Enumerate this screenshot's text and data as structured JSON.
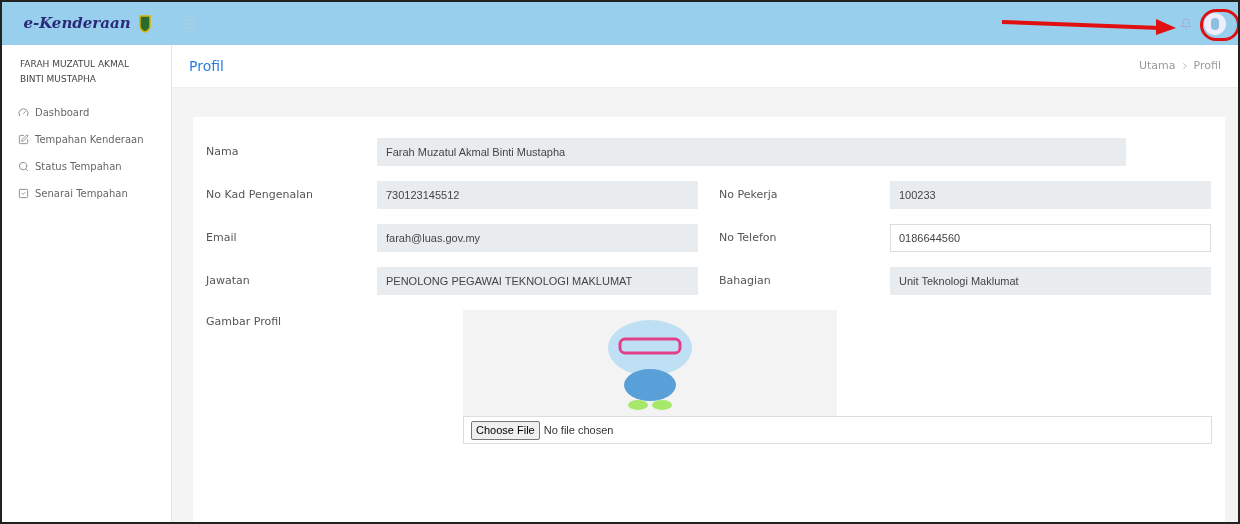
{
  "header": {
    "logo": "e-Kenderaan"
  },
  "sidebar": {
    "user": "FARAH MUZATUL AKMAL BINTI MUSTAPHA",
    "items": [
      {
        "label": "Dashboard",
        "kind": "dashboard"
      },
      {
        "label": "Tempahan Kenderaan",
        "kind": "edit"
      },
      {
        "label": "Status Tempahan",
        "kind": "search"
      },
      {
        "label": "Senarai Tempahan",
        "kind": "check"
      }
    ]
  },
  "page": {
    "title": "Profil",
    "breadcrumb": [
      "Utama",
      "Profil"
    ]
  },
  "form": {
    "name": {
      "label": "Nama",
      "value": "Farah Muzatul Akmal Binti Mustapha",
      "readonly": true
    },
    "rows": [
      [
        {
          "label": "No Kad Pengenalan",
          "value": "730123145512",
          "readonly": true
        },
        {
          "label": "No Pekerja",
          "value": "100233",
          "readonly": true
        }
      ],
      [
        {
          "label": "Email",
          "value": "farah@luas.gov.my",
          "readonly": true
        },
        {
          "label": "No Telefon",
          "value": "0186644560",
          "readonly": false
        }
      ],
      [
        {
          "label": "Jawatan",
          "value": "PENOLONG PEGAWAI TEKNOLOGI MAKLUMAT",
          "readonly": true
        },
        {
          "label": "Bahagian",
          "value": "Unit Teknologi Maklumat",
          "readonly": true
        }
      ]
    ],
    "picture": {
      "label": "Gambar Profil",
      "button": "Choose File",
      "status": "No file chosen"
    }
  }
}
